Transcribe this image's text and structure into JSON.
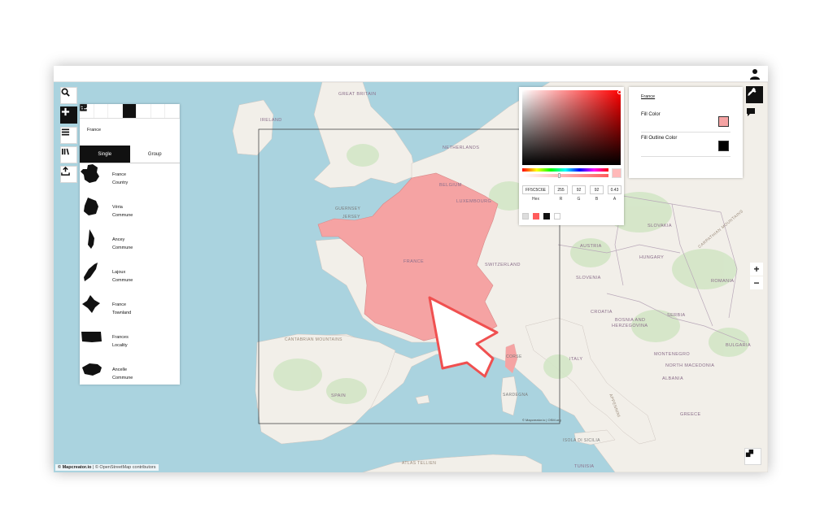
{
  "attribution": {
    "brand": "© Mapcreator.io",
    "osm": "| © OpenStreetMap contributors"
  },
  "bbox_attribution": "© Mapcreator.io | OSM.org",
  "sidebar": {
    "search_icon": "search-icon",
    "add_icon": "plus-icon",
    "menu_icon": "hamburger-icon",
    "library_icon": "library-icon",
    "export_icon": "export-icon"
  },
  "layer_panel": {
    "search_term": "France",
    "tabs": [
      {
        "label": "Single",
        "active": true
      },
      {
        "label": "Group",
        "active": false
      }
    ],
    "results": [
      {
        "name": "France",
        "type": "Country"
      },
      {
        "name": "Véria",
        "type": "Commune"
      },
      {
        "name": "Ancey",
        "type": "Commune"
      },
      {
        "name": "Lajoux",
        "type": "Commune"
      },
      {
        "name": "France",
        "type": "Townland"
      },
      {
        "name": "Frances",
        "type": "Locality"
      },
      {
        "name": "Ancelle",
        "type": "Commune"
      }
    ]
  },
  "color_picker": {
    "hex": "FF5C5C6E",
    "r": "255",
    "g": "92",
    "b": "92",
    "a": "0.43",
    "labels": {
      "hex": "Hex",
      "r": "R",
      "g": "G",
      "b": "B",
      "a": "A"
    },
    "alpha_level": 0.43,
    "swatches": [
      "#dddddd",
      "#ff5c5c",
      "#111111",
      "#ffffff"
    ]
  },
  "style_panel": {
    "title": "France",
    "fill_label": "Fill Color",
    "outline_label": "Fill Outline Color",
    "fill_color": "#f5a3a3",
    "outline_color": "#000000"
  },
  "zoom": {
    "in": "+",
    "out": "−"
  },
  "map_labels": {
    "ireland": "IRELAND",
    "great_britain": "GREAT BRITAIN",
    "netherlands": "NETHERLANDS",
    "belgium": "BELGIUM",
    "luxembourg": "LUXEMBOURG",
    "guernsey": "GUERNSEY",
    "jersey": "JERSEY",
    "france": "FRANCE",
    "switzerland": "SWITZERLAND",
    "austria": "AUSTRIA",
    "slovakia": "SLOVAKIA",
    "hungary": "HUNGARY",
    "slovenia": "SLOVENIA",
    "croatia": "CROATIA",
    "bosnia": "BOSNIA AND",
    "herzegovina": "HERZEGOVINA",
    "serbia": "SERBIA",
    "romania": "ROMANIA",
    "bulgaria": "BULGARIA",
    "italy": "ITALY",
    "spain": "SPAIN",
    "cantabrian": "CANTABRIAN MOUNTAINS",
    "carpathian": "CARPATHIAN MOUNTAINS",
    "montenegro": "MONTENEGRO",
    "north_macedonia": "NORTH MACEDONIA",
    "albania": "ALBANIA",
    "greece": "GREECE",
    "corsica": "CORSE",
    "sardinia": "SARDEGNA",
    "atlas": "ATLAS TELLIEN",
    "tunisia": "TUNISIA",
    "isola": "ISOLA DI SICILIA",
    "apennines": "APPENNINI"
  },
  "colors": {
    "sea": "#aad3df",
    "land": "#f2efe9",
    "green": "#d3e6c6",
    "france_fill": "#f5a3a3",
    "cursor": "#f05050"
  }
}
